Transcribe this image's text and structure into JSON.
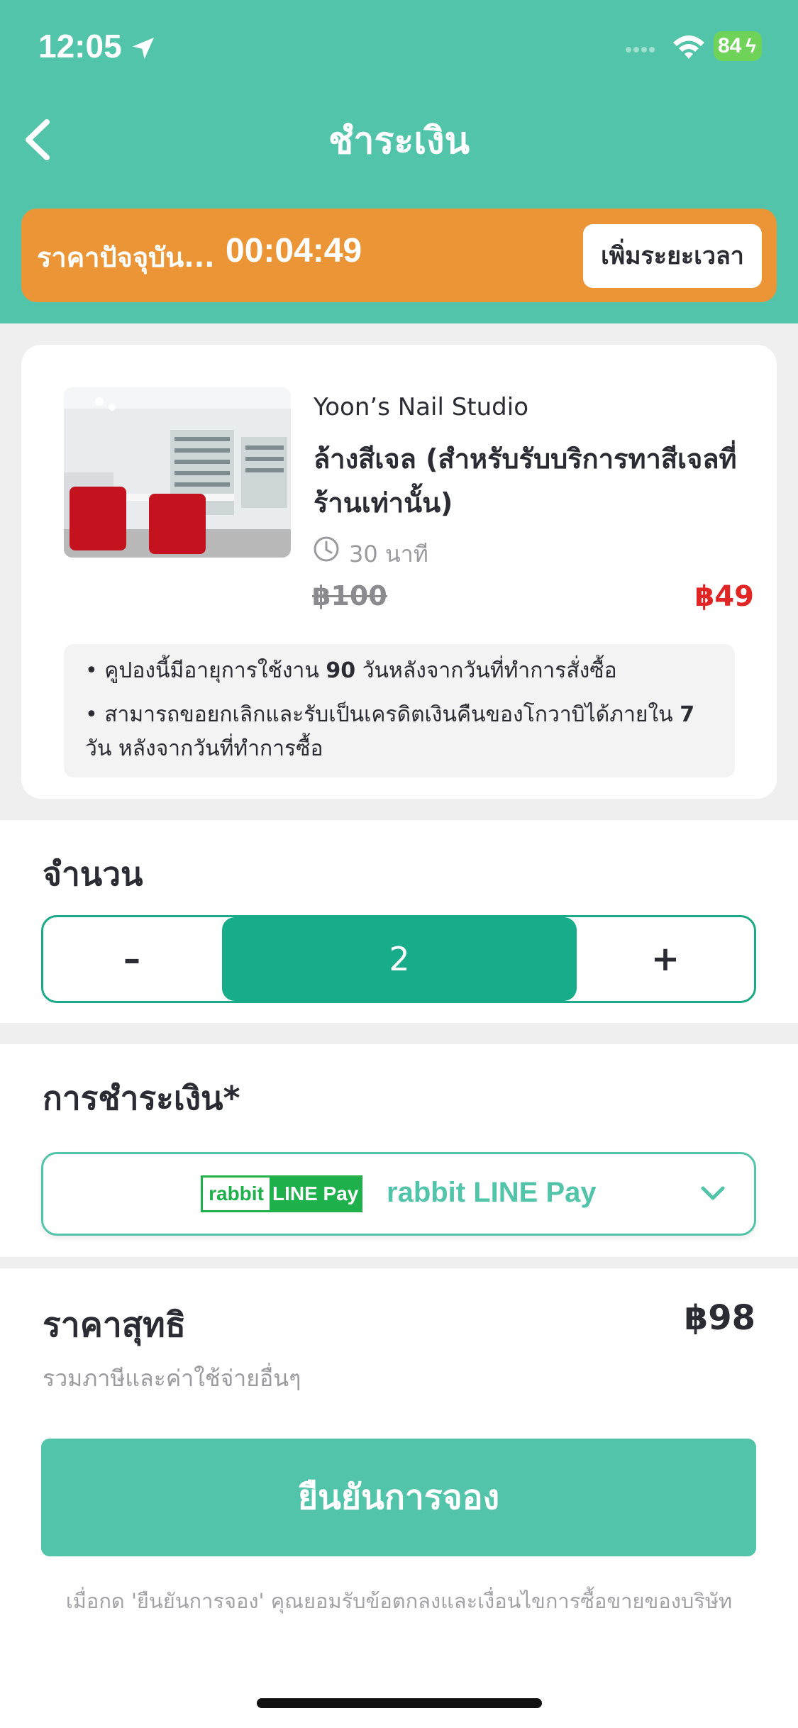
{
  "status_bar": {
    "time": "12:05",
    "battery": "84"
  },
  "header": {
    "title": "ชำระเงิน"
  },
  "timer": {
    "label": "ราคาปัจจุบัน...",
    "value": "00:04:49",
    "extend_label": "เพิ่มระยะเวลา"
  },
  "item": {
    "shop": "Yoon’s Nail Studio",
    "name_line1": "ล้างสีเจล (สำหรับรับบริการทาสีเจลที่",
    "name_line2": "ร้านเท่านั้น)",
    "duration": "30 นาที",
    "old_price": "฿100",
    "new_price": "฿49",
    "notes": {
      "n1_pre": "• คูปองนี้มีอายุการใช้งาน ",
      "n1_bold": "90",
      "n1_post": " วันหลังจากวันที่ทำการสั่งซื้อ",
      "n2_pre": "• สามารถขอยกเลิกและรับเป็นเครดิตเงินคืนของโกวาบิได้ภายใน ",
      "n2_bold": "7",
      "n2_post": " วัน หลังจากวันที่ทำการซื้อ"
    }
  },
  "quantity": {
    "title": "จำนวน",
    "minus": "–",
    "value": "2",
    "plus": "+"
  },
  "payment": {
    "title": "การชำระเงิน*",
    "logo_rabbit": "rabbit",
    "logo_linepay": "LINE Pay",
    "method": "rabbit LINE Pay"
  },
  "total": {
    "label": "ราคาสุทธิ",
    "value": "฿98",
    "subtext": "รวมภาษีและค่าใช้จ่ายอื่นๆ",
    "confirm": "ยืนยันการจอง",
    "terms": "เมื่อกด 'ยืนยันการจอง' คุณยอมรับข้อตกลงและเงื่อนไขการซื้อขายของบริษัท"
  },
  "colors": {
    "brand": "#52c4a9",
    "timer": "#ec9537",
    "price_red": "#e12424",
    "stepper_fill": "#17ad8a"
  }
}
